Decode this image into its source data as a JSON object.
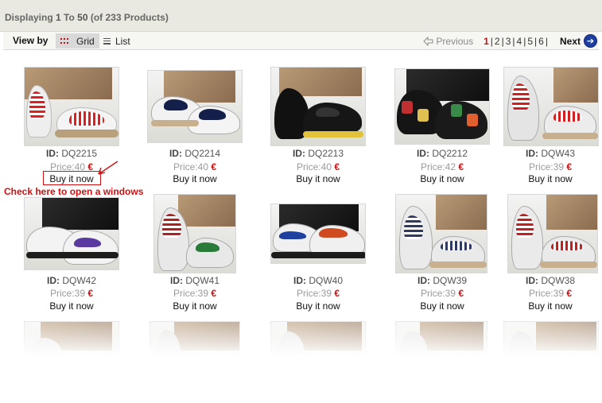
{
  "summary": {
    "prefix": "Displaying ",
    "from": "1",
    "to_word": " To ",
    "to": "50",
    "suffix": "  (of 233  Products)"
  },
  "view": {
    "label": "View by",
    "grid_label": "Grid",
    "list_label": "List",
    "active": "grid"
  },
  "pager": {
    "previous": "Previous",
    "pages": [
      "1",
      "2",
      "3",
      "4",
      "5",
      "6"
    ],
    "current": "1",
    "separator": "|",
    "next": "Next"
  },
  "colors": {
    "accent_red": "#d01010",
    "nav_blue": "#2040a0",
    "header_bg": "#e9e9e1"
  },
  "labels": {
    "id_prefix": "ID:",
    "price_prefix": "Price:",
    "currency": "€",
    "buy": "Buy it now"
  },
  "annotation": "Check here to open a windows",
  "products": [
    {
      "id": "DQ2215",
      "price": "40"
    },
    {
      "id": "DQ2214",
      "price": "40"
    },
    {
      "id": "DQ2213",
      "price": "40"
    },
    {
      "id": "DQ2212",
      "price": "42"
    },
    {
      "id": "DQW43",
      "price": "39"
    },
    {
      "id": "DQW42",
      "price": "39"
    },
    {
      "id": "DQW41",
      "price": "39"
    },
    {
      "id": "DQW40",
      "price": "39"
    },
    {
      "id": "DQW39",
      "price": "39"
    },
    {
      "id": "DQW38",
      "price": "39"
    }
  ]
}
